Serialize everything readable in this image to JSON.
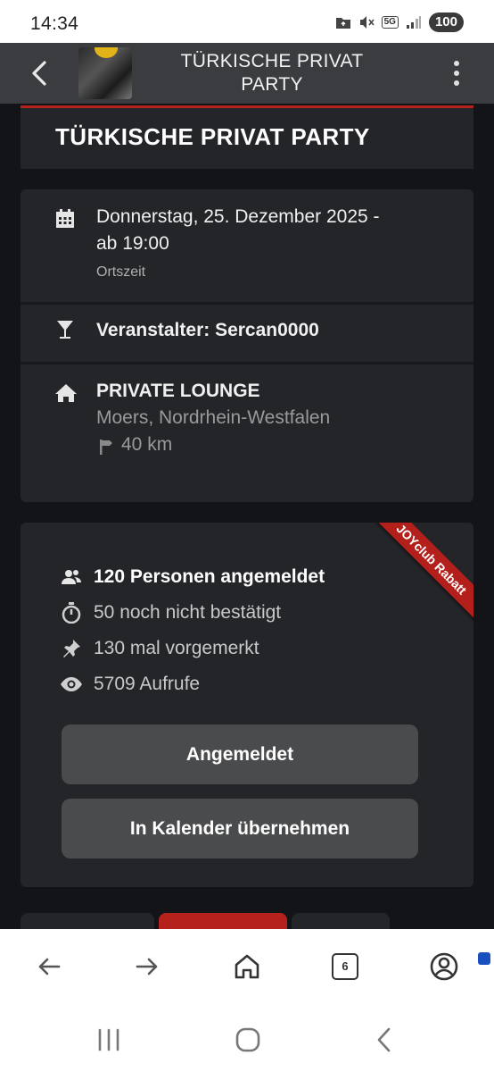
{
  "status_bar": {
    "time": "14:34",
    "network": "5G",
    "battery": "100"
  },
  "header": {
    "title": "TÜRKISCHE PRIVAT PARTY"
  },
  "event": {
    "title": "TÜRKISCHE PRIVAT PARTY",
    "date_line1": "Donnerstag, 25. Dezember 2025 -",
    "date_line2": "ab 19:00",
    "timezone_note": "Ortszeit",
    "organizer": "Veranstalter: Sercan0000",
    "venue_name": "PRIVATE LOUNGE",
    "venue_location": "Moers, Nordrhein-Westfalen",
    "distance": "40 km"
  },
  "stats": {
    "ribbon": "JOYclub Rabatt",
    "items": [
      {
        "icon": "people-icon",
        "text": "120 Personen angemeldet"
      },
      {
        "icon": "stopwatch-icon",
        "text": "50 noch nicht bestätigt"
      },
      {
        "icon": "pin-icon",
        "text": "130 mal vorgemerkt"
      },
      {
        "icon": "eye-icon",
        "text": "5709 Aufrufe"
      }
    ],
    "registered_button": "Angemeldet",
    "calendar_button": "In Kalender übernehmen"
  },
  "browser": {
    "tab_count": "6"
  },
  "colors": {
    "accent_red": "#b5221c",
    "card_bg": "#232529",
    "page_bg": "#131417",
    "button_bg": "#4a4b4d"
  }
}
